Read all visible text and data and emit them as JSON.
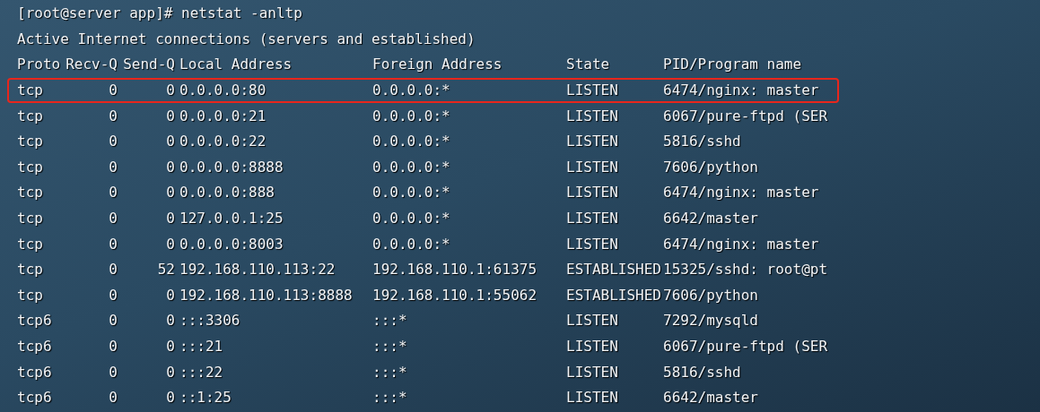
{
  "prompt": "[root@server app]# netstat -anltp",
  "title": "Active Internet connections (servers and established)",
  "columns": [
    "Proto",
    "Recv-Q",
    "Send-Q",
    "Local Address",
    "Foreign Address",
    "State",
    "PID/Program name"
  ],
  "rows": [
    {
      "proto": "tcp",
      "recv_q": "0",
      "send_q": "0",
      "local": "0.0.0.0:80",
      "foreign": "0.0.0.0:*",
      "state": "LISTEN",
      "program": "6474/nginx: master",
      "highlighted": true
    },
    {
      "proto": "tcp",
      "recv_q": "0",
      "send_q": "0",
      "local": "0.0.0.0:21",
      "foreign": "0.0.0.0:*",
      "state": "LISTEN",
      "program": "6067/pure-ftpd (SER",
      "highlighted": false
    },
    {
      "proto": "tcp",
      "recv_q": "0",
      "send_q": "0",
      "local": "0.0.0.0:22",
      "foreign": "0.0.0.0:*",
      "state": "LISTEN",
      "program": "5816/sshd",
      "highlighted": false
    },
    {
      "proto": "tcp",
      "recv_q": "0",
      "send_q": "0",
      "local": "0.0.0.0:8888",
      "foreign": "0.0.0.0:*",
      "state": "LISTEN",
      "program": "7606/python",
      "highlighted": false
    },
    {
      "proto": "tcp",
      "recv_q": "0",
      "send_q": "0",
      "local": "0.0.0.0:888",
      "foreign": "0.0.0.0:*",
      "state": "LISTEN",
      "program": "6474/nginx: master",
      "highlighted": false
    },
    {
      "proto": "tcp",
      "recv_q": "0",
      "send_q": "0",
      "local": "127.0.0.1:25",
      "foreign": "0.0.0.0:*",
      "state": "LISTEN",
      "program": "6642/master",
      "highlighted": false
    },
    {
      "proto": "tcp",
      "recv_q": "0",
      "send_q": "0",
      "local": "0.0.0.0:8003",
      "foreign": "0.0.0.0:*",
      "state": "LISTEN",
      "program": "6474/nginx: master",
      "highlighted": false
    },
    {
      "proto": "tcp",
      "recv_q": "0",
      "send_q": "52",
      "local": "192.168.110.113:22",
      "foreign": "192.168.110.1:61375",
      "state": "ESTABLISHED",
      "program": "15325/sshd: root@pt",
      "highlighted": false
    },
    {
      "proto": "tcp",
      "recv_q": "0",
      "send_q": "0",
      "local": "192.168.110.113:8888",
      "foreign": "192.168.110.1:55062",
      "state": "ESTABLISHED",
      "program": "7606/python",
      "highlighted": false
    },
    {
      "proto": "tcp6",
      "recv_q": "0",
      "send_q": "0",
      "local": ":::3306",
      "foreign": ":::*",
      "state": "LISTEN",
      "program": "7292/mysqld",
      "highlighted": false
    },
    {
      "proto": "tcp6",
      "recv_q": "0",
      "send_q": "0",
      "local": ":::21",
      "foreign": ":::*",
      "state": "LISTEN",
      "program": "6067/pure-ftpd (SER",
      "highlighted": false
    },
    {
      "proto": "tcp6",
      "recv_q": "0",
      "send_q": "0",
      "local": ":::22",
      "foreign": ":::*",
      "state": "LISTEN",
      "program": "5816/sshd",
      "highlighted": false
    },
    {
      "proto": "tcp6",
      "recv_q": "0",
      "send_q": "0",
      "local": "::1:25",
      "foreign": ":::*",
      "state": "LISTEN",
      "program": "6642/master",
      "highlighted": false
    }
  ]
}
